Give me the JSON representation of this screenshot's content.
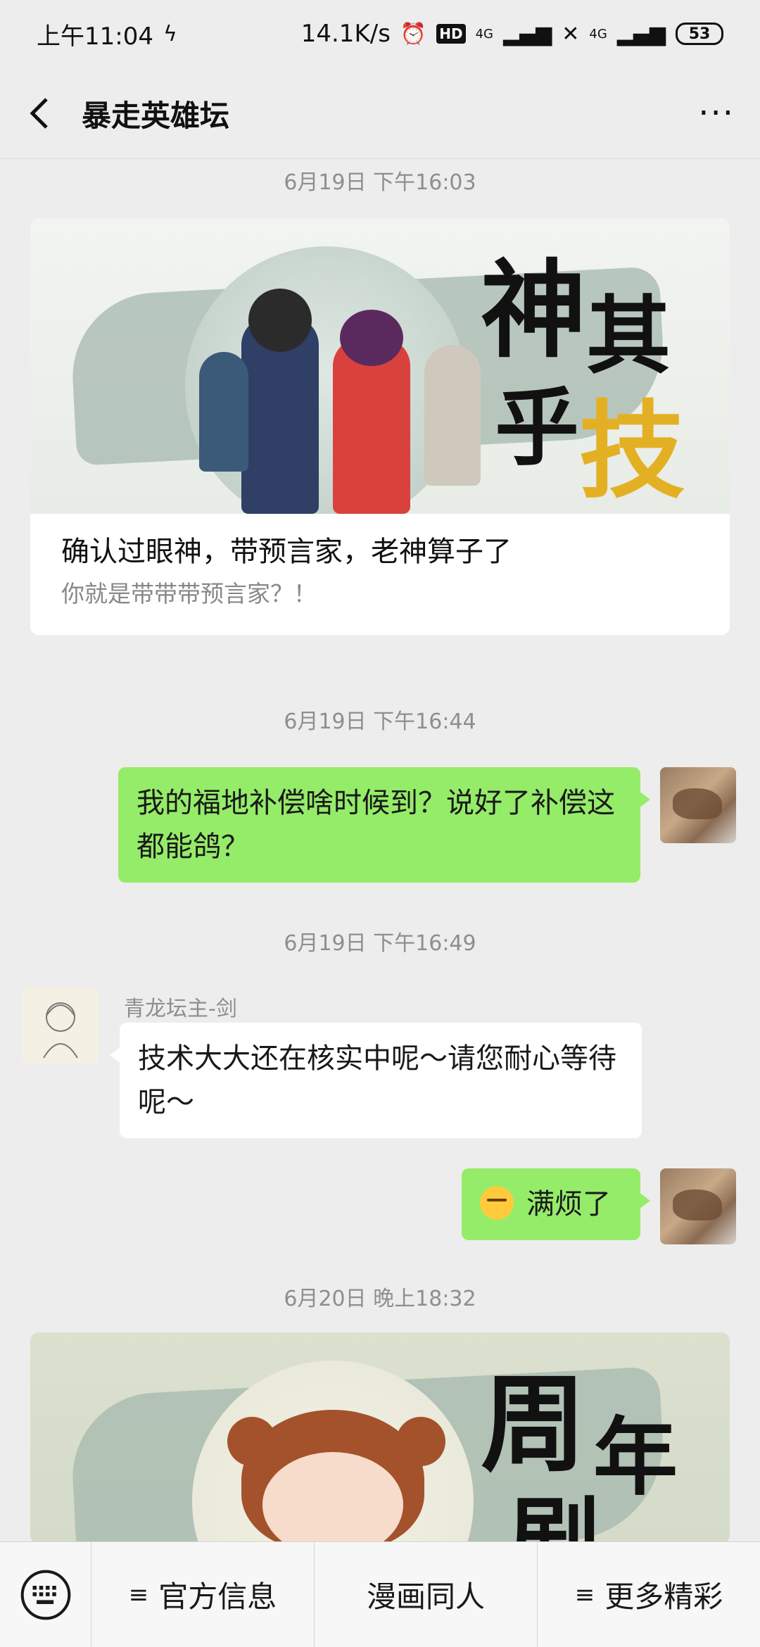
{
  "status_bar": {
    "time": "上午11:04",
    "network_speed": "14.1K/s",
    "hd_label": "HD",
    "signal_label_1": "4G",
    "signal_label_2": "4G",
    "battery": "53"
  },
  "header": {
    "title": "暴走英雄坛",
    "back_icon": "chevron-left-icon",
    "more_icon": "more-dots-icon"
  },
  "messages": [
    {
      "type": "timestamp",
      "text": "6月19日 下午16:03"
    },
    {
      "type": "article_card",
      "image_caption_chars": [
        "神",
        "其",
        "乎",
        "技"
      ],
      "title": "确认过眼神，带预言家，老神算子了",
      "description": "你就是带带带预言家？！"
    },
    {
      "type": "timestamp",
      "text": "6月19日 下午16:44"
    },
    {
      "type": "text",
      "sender": "me",
      "text": "我的福地补偿啥时候到？说好了补偿这都能鸽？"
    },
    {
      "type": "timestamp",
      "text": "6月19日 下午16:49"
    },
    {
      "type": "text",
      "sender": "other",
      "sender_name": "青龙坛主-剑",
      "text": "技术大大还在核实中呢～请您耐心等待呢～"
    },
    {
      "type": "text",
      "sender": "me",
      "emoji": "annoyed-face-emoji",
      "text": "满烦了"
    },
    {
      "type": "timestamp",
      "text": "6月20日 晚上18:32"
    },
    {
      "type": "article_card",
      "image_caption_chars": [
        "周",
        "年",
        "剧"
      ]
    }
  ],
  "bottom_menu": {
    "keyboard_icon": "keyboard-icon",
    "items": [
      {
        "glyph": "≡",
        "label": "官方信息"
      },
      {
        "glyph": "",
        "label": "漫画同人"
      },
      {
        "glyph": "≡",
        "label": "更多精彩"
      }
    ]
  },
  "colors": {
    "background": "#ededed",
    "my_bubble": "#95ec69",
    "other_bubble": "#ffffff",
    "timestamp": "#8e8e8e",
    "gold_accent": "#e3b024"
  }
}
